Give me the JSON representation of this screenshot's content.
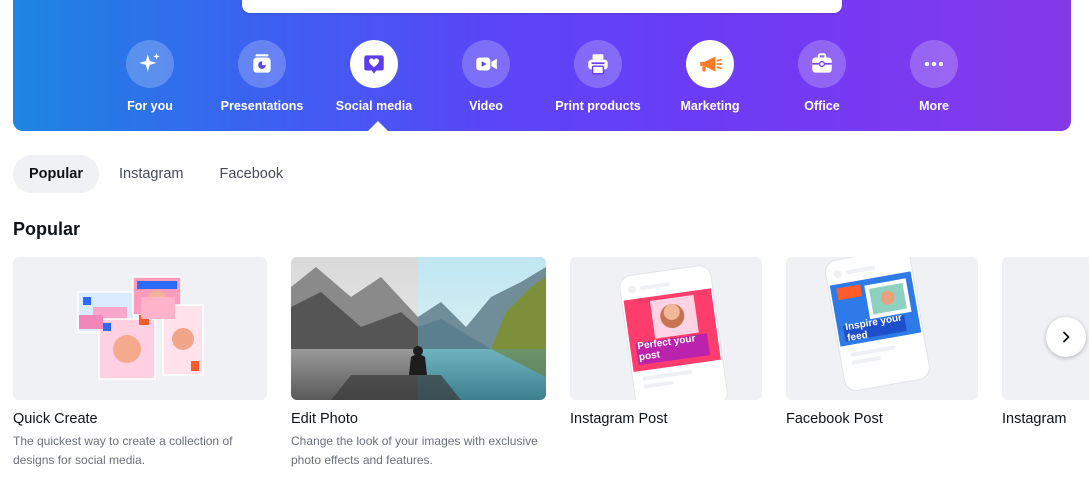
{
  "categories": [
    {
      "label": "For you",
      "icon": "sparkle-icon"
    },
    {
      "label": "Presentations",
      "icon": "presentation-icon"
    },
    {
      "label": "Social media",
      "icon": "heart-chat-icon"
    },
    {
      "label": "Video",
      "icon": "video-camera-icon"
    },
    {
      "label": "Print products",
      "icon": "printer-icon"
    },
    {
      "label": "Marketing",
      "icon": "megaphone-icon"
    },
    {
      "label": "Office",
      "icon": "briefcase-icon"
    },
    {
      "label": "More",
      "icon": "more-dots-icon"
    }
  ],
  "active_category": "Social media",
  "tabs": [
    {
      "label": "Popular"
    },
    {
      "label": "Instagram"
    },
    {
      "label": "Facebook"
    }
  ],
  "section": {
    "title": "Popular"
  },
  "cards": [
    {
      "title": "Quick Create",
      "desc": "The quickest way to create a collection of designs for social media."
    },
    {
      "title": "Edit Photo",
      "desc": "Change the look of your images with exclusive photo effects and features."
    },
    {
      "title": "Instagram Post",
      "desc": "",
      "thumb_text": "Perfect your post"
    },
    {
      "title": "Facebook Post",
      "desc": "",
      "thumb_text": "Inspire your feed"
    },
    {
      "title": "Instagram",
      "desc": ""
    }
  ],
  "colors": {
    "accent": "#7d2ae8",
    "marketing": "#ff7a25",
    "text": "#0e1318"
  }
}
